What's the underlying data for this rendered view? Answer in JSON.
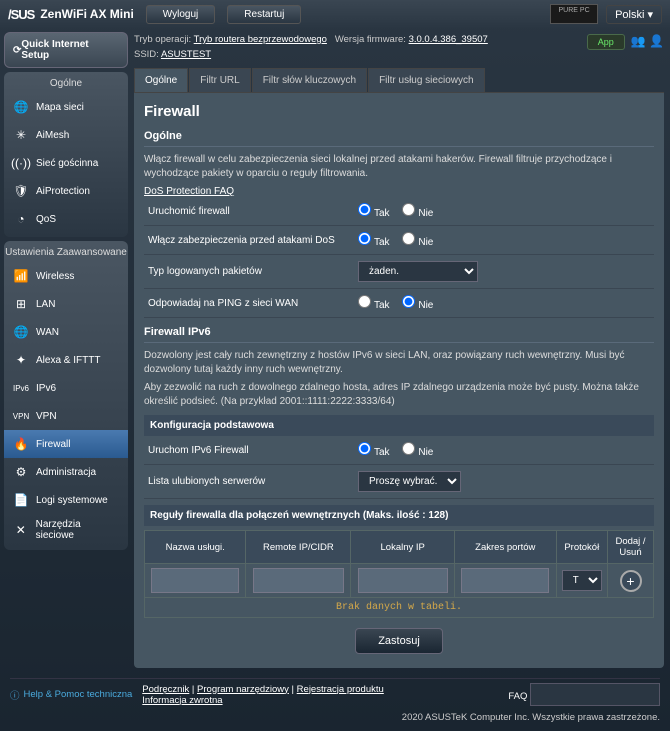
{
  "header": {
    "brand": "/SUS",
    "model": "ZenWiFi AX Mini",
    "logout": "Wyloguj",
    "reboot": "Restartuj",
    "language": "Polski"
  },
  "info": {
    "op_mode_label": "Tryb operacji:",
    "op_mode": "Tryb routera bezprzewodowego",
    "fw_label": "Wersja firmware:",
    "fw": "3.0.0.4.386_39507",
    "ssid_label": "SSID:",
    "ssid": "ASUSTEST",
    "app": "App"
  },
  "sidebar": {
    "qis": "Quick Internet Setup",
    "general_head": "Ogólne",
    "general": [
      {
        "label": "Mapa sieci",
        "icon": "🌐"
      },
      {
        "label": "AiMesh",
        "icon": "✳"
      },
      {
        "label": "Sieć gościnna",
        "icon": "((·))"
      },
      {
        "label": "AiProtection",
        "icon": "🛡"
      },
      {
        "label": "QoS",
        "icon": "◔"
      }
    ],
    "advanced_head": "Ustawienia Zaawansowane",
    "advanced": [
      {
        "label": "Wireless",
        "icon": "📶"
      },
      {
        "label": "LAN",
        "icon": "⊞"
      },
      {
        "label": "WAN",
        "icon": "🌐"
      },
      {
        "label": "Alexa & IFTTT",
        "icon": "✦"
      },
      {
        "label": "IPv6",
        "icon": "IPv6"
      },
      {
        "label": "VPN",
        "icon": "VPN"
      },
      {
        "label": "Firewall",
        "icon": "🔥"
      },
      {
        "label": "Administracja",
        "icon": "⚙"
      },
      {
        "label": "Logi systemowe",
        "icon": "📄"
      },
      {
        "label": "Narzędzia sieciowe",
        "icon": "✕"
      }
    ]
  },
  "tabs": [
    "Ogólne",
    "Filtr URL",
    "Filtr słów kluczowych",
    "Filtr usług sieciowych"
  ],
  "panel": {
    "title": "Firewall",
    "g_head": "Ogólne",
    "g_text": "Włącz firewall w celu zabezpieczenia sieci lokalnej przed atakami hakerów. Firewall filtruje przychodzące i wychodzące pakiety w oparciu o reguły filtrowania.",
    "faq": "DoS Protection FAQ",
    "rows": {
      "r1": "Uruchomić firewall",
      "r2": "Włącz zabezpieczenia przed atakami DoS",
      "r3": "Typ logowanych pakietów",
      "r3_sel": "żaden.",
      "r4": "Odpowiadaj na PING z sieci WAN"
    },
    "yes": "Tak",
    "no": "Nie",
    "ipv6_head": "Firewall IPv6",
    "ipv6_p1": "Dozwolony jest cały ruch zewnętrzny z hostów IPv6 w sieci LAN, oraz powiązany ruch wewnętrzny. Musi być dozwolony tutaj każdy inny ruch wewnętrzny.",
    "ipv6_p2": "Aby zezwolić na ruch z dowolnego zdalnego hosta, adres IP zdalnego urządzenia może być pusty. Można także określić podsieć. (Na przykład 2001::1111:2222:3333/64)",
    "cfg_head": "Konfiguracja podstawowa",
    "r5": "Uruchom IPv6 Firewall",
    "r6": "Lista ulubionych serwerów",
    "r6_sel": "Proszę wybrać.",
    "rules_head": "Reguły firewalla dla połączeń wewnętrznych (Maks. ilość : 128)",
    "th": [
      "Nazwa usługi.",
      "Remote IP/CIDR",
      "Lokalny IP",
      "Zakres portów",
      "Protokół",
      "Dodaj / Usuń"
    ],
    "proto": "TCP",
    "nodata": "Brak danych w tabeli.",
    "apply": "Zastosuj"
  },
  "footer": {
    "help": "Help & Pomoc techniczna",
    "l1": "Podręcznik",
    "l2": "Program narzędziowy",
    "l3": "Rejestracja produktu",
    "l4": "Informacja zwrotna",
    "faq": "FAQ",
    "copy": "2020 ASUSTeK Computer Inc. Wszystkie prawa zastrzeżone."
  }
}
